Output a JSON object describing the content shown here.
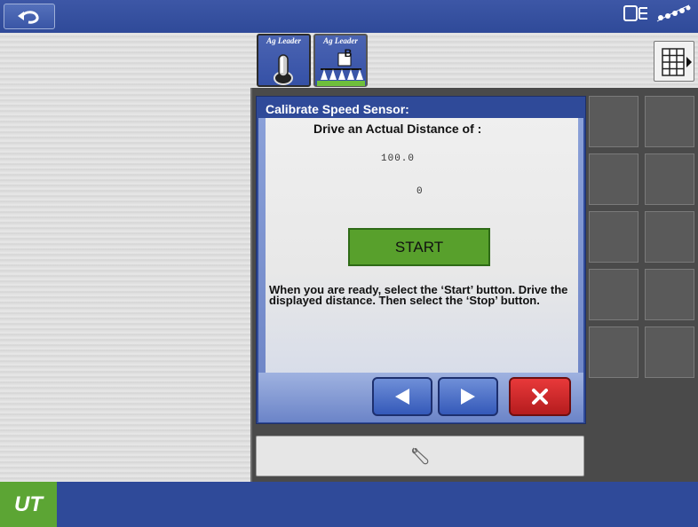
{
  "header": {
    "back_icon": "undo-arrow-icon",
    "status_icons": [
      "implement-status-icon",
      "signal-strength-icon"
    ]
  },
  "tabs": [
    {
      "label": "Ag Leader",
      "icon": "joystick-icon",
      "active": true
    },
    {
      "label": "Ag Leader",
      "badge": "B",
      "icon": "sprayer-icon",
      "active": false
    }
  ],
  "layout_button": {
    "icon": "grid-layout-icon"
  },
  "dialog": {
    "title": "Calibrate Speed Sensor:",
    "distance_label": "Drive an Actual Distance of :",
    "target_distance": "100.0",
    "current_distance": "0",
    "start_label": "START",
    "instructions": "When you are ready, select the ‘Start’ button. Drive the displayed distance. Then select the ‘Stop’ button.",
    "prev_icon": "left-triangle-icon",
    "next_icon": "right-triangle-icon",
    "cancel_icon": "close-x-icon"
  },
  "settings_bar": {
    "icon": "wrench-icon"
  },
  "footer": {
    "logo_text": "UT"
  },
  "colors": {
    "header_blue": "#2f4a99",
    "start_green": "#58a02c",
    "cancel_red": "#c82a2b",
    "logo_green": "#5ca534"
  }
}
